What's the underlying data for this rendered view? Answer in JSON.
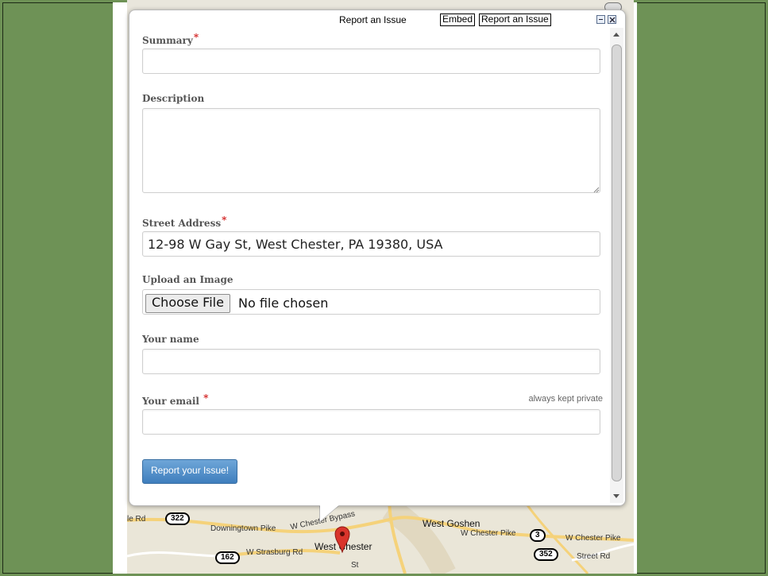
{
  "dialog": {
    "title": "Report an Issue",
    "embed_label": "Embed",
    "report_label": "Report an Issue"
  },
  "form": {
    "summary": {
      "label": "Summary",
      "required_mark": "*",
      "value": ""
    },
    "description": {
      "label": "Description",
      "value": ""
    },
    "address": {
      "label": "Street Address",
      "required_mark": "*",
      "value": "12-98 W Gay St, West Chester, PA 19380, USA"
    },
    "image": {
      "label": "Upload an Image",
      "button_label": "Choose File",
      "status": "No file chosen"
    },
    "name": {
      "label": "Your name",
      "value": ""
    },
    "email": {
      "label": "Your email",
      "required_mark": "*",
      "hint": "always kept private",
      "value": ""
    },
    "submit_label": "Report your Issue!"
  },
  "map": {
    "labels": {
      "le_rd": "le Rd",
      "downingtown_pike": "Downingtown Pike",
      "w_chester_bypass": "W Chester Bypass",
      "west_chester": "West Chester",
      "west_goshen": "West Goshen",
      "w_chester_pike_1": "W Chester Pike",
      "w_chester_pike_2": "W Chester Pike",
      "w_strasburg_rd": "W Strasburg Rd",
      "street_rd": "Street Rd",
      "st": "St"
    },
    "shields": {
      "r322": "322",
      "r162": "162",
      "r3": "3",
      "r352": "352"
    }
  },
  "colors": {
    "background": "#6e9256",
    "accent_button": "#4c8bc4",
    "required_mark": "#d21e1e",
    "marker": "#d9342b"
  }
}
